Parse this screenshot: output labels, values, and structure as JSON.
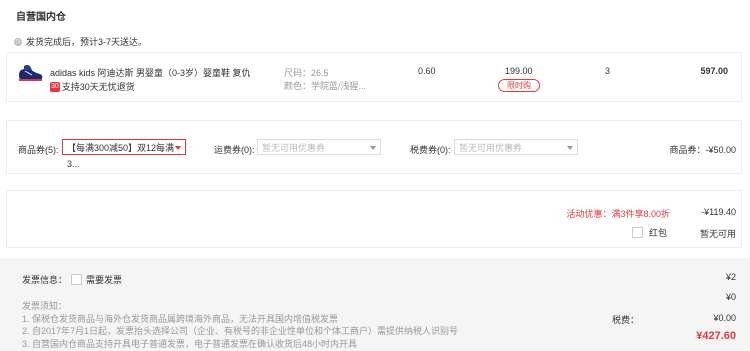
{
  "store": {
    "title": "自营国内仓"
  },
  "shipping_notice": "发货完成后，预计3-7天送达。",
  "item": {
    "name": "adidas kids 阿迪达斯 男婴童（0-3岁）婴童鞋 复仇...",
    "service_badge": "30",
    "service_text": "支持30天无忧退货",
    "size": "尺码：26.5",
    "color": "颜色：学院蓝/浅猩...",
    "tax": "0.60",
    "price": "199.00",
    "price_tag": "限时购",
    "quantity": "3",
    "total": "597.00"
  },
  "coupons": {
    "goods_label": "商品券(5):",
    "goods_value": "【每满300减50】双12每满3...",
    "freight_label": "运费券(0):",
    "freight_value": "暂无可用优惠券",
    "tax_label": "税费券(0):",
    "tax_value": "暂无可用优惠券",
    "summary": "商品券：-¥50.00"
  },
  "promo": {
    "label": "活动优惠：满3件享8.00折",
    "amount": "-¥119.40",
    "red_packet": "红包",
    "red_packet_status": "暂无可用"
  },
  "invoice": {
    "label": "发票信息：",
    "option": "需要发票"
  },
  "notes": {
    "title": "发票须知：",
    "line1": "1. 保税仓发货商品与海外仓发货商品属跨境海外商品，无法开具国内增值税发票",
    "line2": "2. 自2017年7月1日起，发票抬头选择公司（企业、有税号的非企业性单位和个体工商户）需提供纳税人识别号",
    "line3": "3. 自营国内仓商品支持开具电子普通发票，电子普通发票在确认收货后48小时内开具"
  },
  "summary": {
    "row1_value": "¥2",
    "row2_value": "¥0",
    "row3_value": "¥0.00",
    "row4_label": "税费：",
    "pay_value": "¥427.60"
  },
  "colors": {
    "accent": "#e4393c"
  }
}
